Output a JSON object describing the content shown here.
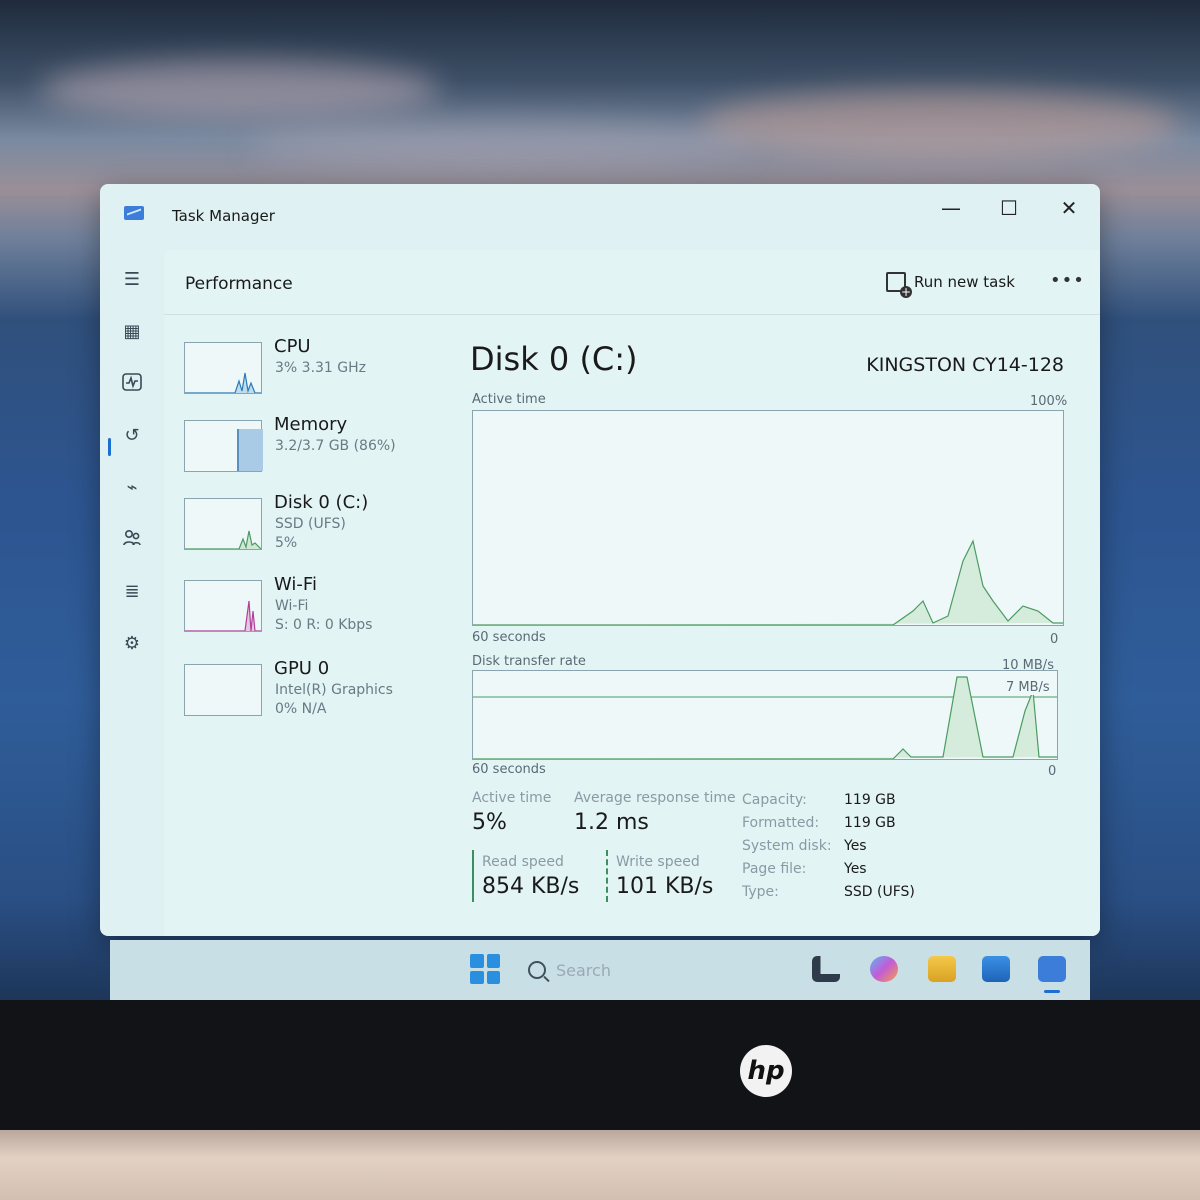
{
  "window": {
    "title": "Task Manager",
    "minimize": "—",
    "maximize": "☐",
    "close": "✕"
  },
  "nav": [
    {
      "name": "hamburger-icon",
      "glyph": "☰"
    },
    {
      "name": "processes-icon",
      "glyph": "▦"
    },
    {
      "name": "performance-icon",
      "glyph": "📈"
    },
    {
      "name": "app-history-icon",
      "glyph": "↺"
    },
    {
      "name": "startup-apps-icon",
      "glyph": "⌁"
    },
    {
      "name": "users-icon",
      "glyph": "👥"
    },
    {
      "name": "details-icon",
      "glyph": "≣"
    },
    {
      "name": "services-icon",
      "glyph": "⚙"
    }
  ],
  "header": {
    "title": "Performance",
    "run_task": "Run new task",
    "more": "•••"
  },
  "resources": [
    {
      "name": "CPU",
      "sub1": "3% 3.31 GHz"
    },
    {
      "name": "Memory",
      "sub1": "3.2/3.7 GB (86%)"
    },
    {
      "name": "Disk 0 (C:)",
      "sub1": "SSD (UFS)",
      "sub2": "5%"
    },
    {
      "name": "Wi-Fi",
      "sub1": "Wi-Fi",
      "sub2": "S: 0 R: 0 Kbps"
    },
    {
      "name": "GPU 0",
      "sub1": "Intel(R) Graphics",
      "sub2": "0% N/A"
    }
  ],
  "detail": {
    "title": "Disk 0 (C:)",
    "model": "KINGSTON CY14-128",
    "active_time_label": "Active time",
    "active_time_max": "100%",
    "seconds_label": "60 seconds",
    "zero": "0",
    "transfer_label": "Disk transfer rate",
    "transfer_max": "10 MB/s",
    "transfer_mark": "7 MB/s",
    "stats": {
      "active_time_label": "Active time",
      "active_time": "5%",
      "avg_resp_label": "Average response time",
      "avg_resp": "1.2 ms",
      "read_label": "Read speed",
      "read": "854 KB/s",
      "write_label": "Write speed",
      "write": "101 KB/s"
    },
    "props": [
      {
        "k": "Capacity:",
        "v": "119 GB"
      },
      {
        "k": "Formatted:",
        "v": "119 GB"
      },
      {
        "k": "System disk:",
        "v": "Yes"
      },
      {
        "k": "Page file:",
        "v": "Yes"
      },
      {
        "k": "Type:",
        "v": "SSD (UFS)"
      }
    ]
  },
  "taskbar": {
    "search_placeholder": "Search"
  },
  "laptop": {
    "logo": "hp"
  }
}
